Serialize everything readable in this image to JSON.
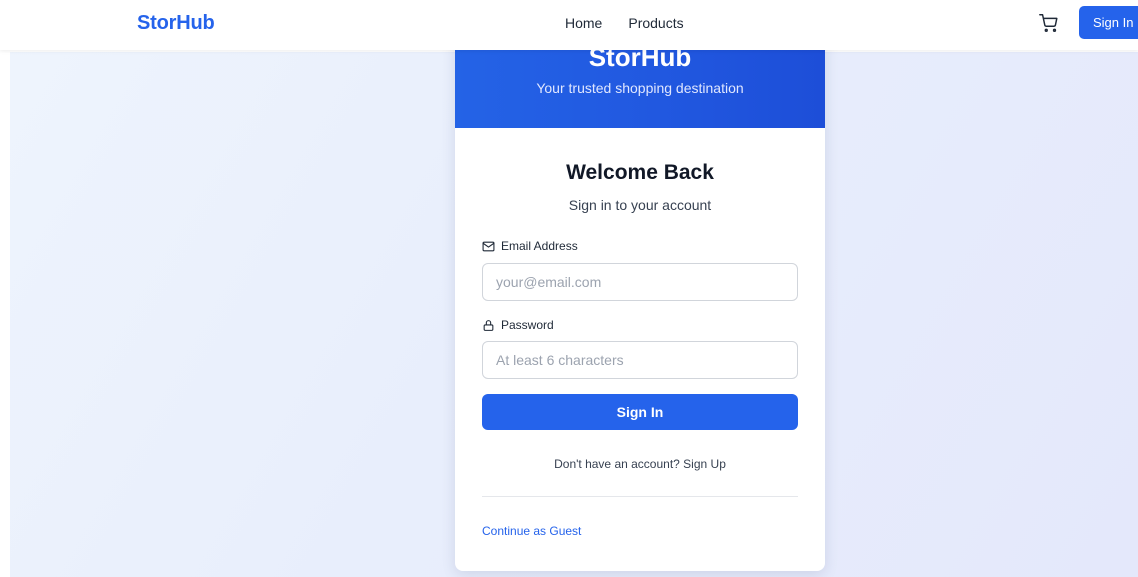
{
  "topbar": {
    "brand": "StorHub",
    "nav": [
      "Home",
      "Products"
    ],
    "sign_in_label": "Sign In",
    "cart_icon": "cart-icon"
  },
  "card": {
    "header_title": "StorHub",
    "tagline": "Your trusted shopping destination",
    "welcome": "Welcome Back",
    "subtitle": "Sign in to your account",
    "email": {
      "label": "Email Address",
      "placeholder": "your@email.com",
      "value": "",
      "icon": "mail-icon"
    },
    "password": {
      "label": "Password",
      "placeholder": "At least 6 characters",
      "value": "",
      "icon": "lock-icon"
    },
    "submit_label": "Sign In",
    "signup_prompt": "Don't have an account?",
    "signup_link": "Sign Up",
    "guest_link": "Continue as Guest"
  },
  "colors": {
    "accent": "#2563eb",
    "header_gradient_end": "#1d4ed8",
    "background": "#e8eefc"
  }
}
